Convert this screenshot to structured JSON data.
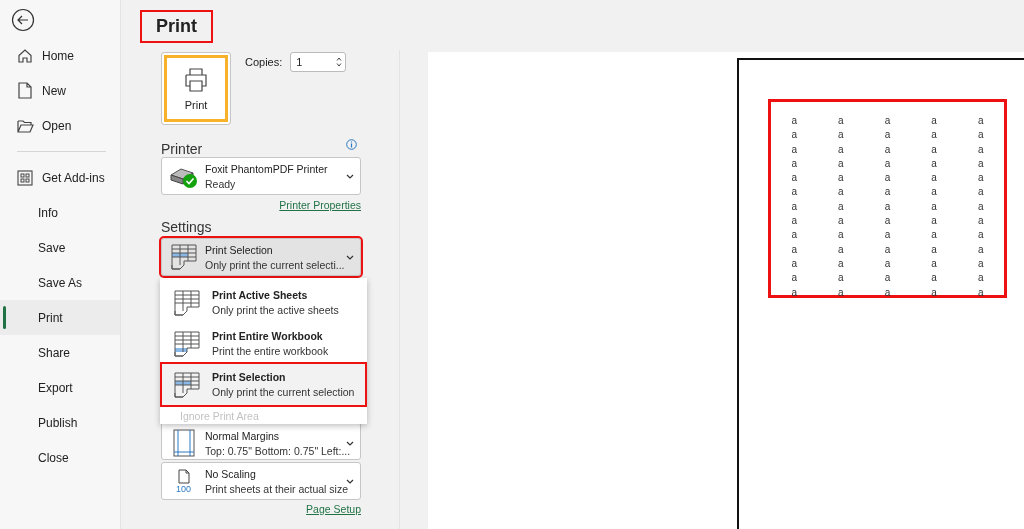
{
  "sidebar": {
    "sections": [
      {
        "items": [
          {
            "label": "Home",
            "selected": false
          },
          {
            "label": "New",
            "selected": false
          },
          {
            "label": "Open",
            "selected": false
          }
        ]
      },
      {
        "items": [
          {
            "label": "Get Add-ins",
            "selected": false
          },
          {
            "label": "Info",
            "selected": false
          },
          {
            "label": "Save",
            "selected": false
          },
          {
            "label": "Save As",
            "selected": false
          },
          {
            "label": "Print",
            "selected": true
          },
          {
            "label": "Share",
            "selected": false
          },
          {
            "label": "Export",
            "selected": false
          },
          {
            "label": "Publish",
            "selected": false
          },
          {
            "label": "Close",
            "selected": false
          }
        ]
      }
    ]
  },
  "page_title": {
    "text": "Print",
    "highlighted": true
  },
  "print_button": {
    "label": "Print"
  },
  "copies": {
    "label": "Copies:",
    "value": "1"
  },
  "printer": {
    "heading": "Printer",
    "name": "Foxit PhantomPDF Printer",
    "status": "Ready",
    "properties_link": "Printer Properties"
  },
  "settings": {
    "heading": "Settings",
    "selection_dropdown": {
      "title": "Print Selection",
      "subtitle": "Only print the current selecti...",
      "expanded": true,
      "highlighted": true
    },
    "menu": {
      "options": [
        {
          "title": "Print Active Sheets",
          "subtitle": "Only print the active sheets",
          "selected": false,
          "highlighted": false
        },
        {
          "title": "Print Entire Workbook",
          "subtitle": "Print the entire workbook",
          "selected": false,
          "highlighted": false
        },
        {
          "title": "Print Selection",
          "subtitle": "Only print the current selection",
          "selected": true,
          "highlighted": true
        }
      ],
      "extra_item": {
        "label": "Ignore Print Area",
        "disabled": true
      }
    },
    "margins_dropdown": {
      "title": "Normal Margins",
      "subtitle": "Top: 0.75\" Bottom: 0.75\" Left:..."
    },
    "scaling_dropdown": {
      "title": "No Scaling",
      "subtitle": "Print sheets at their actual size",
      "icon_text": "100"
    },
    "page_setup_link": "Page Setup"
  },
  "preview": {
    "highlighted": true,
    "rows": [
      [
        "a",
        "a",
        "a",
        "a",
        "a"
      ],
      [
        "a",
        "a",
        "a",
        "a",
        "a"
      ],
      [
        "a",
        "a",
        "a",
        "a",
        "a"
      ],
      [
        "a",
        "a",
        "a",
        "a",
        "a"
      ],
      [
        "a",
        "a",
        "a",
        "a",
        "a"
      ],
      [
        "a",
        "a",
        "a",
        "a",
        "a"
      ],
      [
        "a",
        "a",
        "a",
        "a",
        "a"
      ],
      [
        "a",
        "a",
        "a",
        "a",
        "a"
      ],
      [
        "a",
        "a",
        "a",
        "a",
        "a"
      ],
      [
        "a",
        "a",
        "a",
        "a",
        "a"
      ],
      [
        "a",
        "a",
        "a",
        "a",
        "a"
      ],
      [
        "a",
        "a",
        "a",
        "a",
        "a"
      ],
      [
        "a",
        "a",
        "a",
        "a",
        "a"
      ]
    ]
  }
}
